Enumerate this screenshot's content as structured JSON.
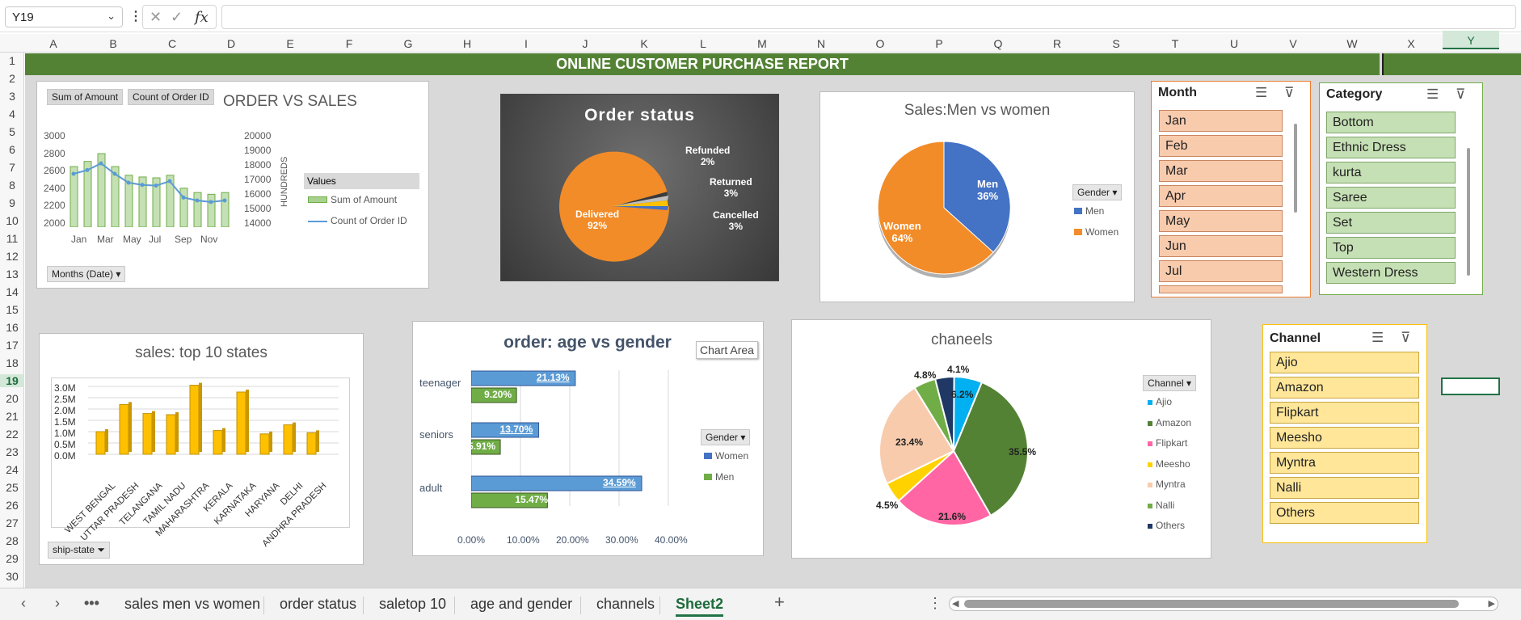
{
  "formula_bar": {
    "name_box": "Y19",
    "fx": "fx",
    "formula": ""
  },
  "columns": [
    [
      "A",
      66
    ],
    [
      "B",
      140
    ],
    [
      "C",
      213
    ],
    [
      "D",
      286
    ],
    [
      "E",
      359
    ],
    [
      "F",
      432
    ],
    [
      "G",
      505
    ],
    [
      "H",
      578
    ],
    [
      "I",
      651
    ],
    [
      "J",
      724
    ],
    [
      "K",
      797
    ],
    [
      "L",
      870
    ],
    [
      "M",
      943
    ],
    [
      "N",
      1016
    ],
    [
      "O",
      1089
    ],
    [
      "P",
      1162
    ],
    [
      "Q",
      1235
    ],
    [
      "R",
      1308
    ],
    [
      "S",
      1381
    ],
    [
      "T",
      1454
    ],
    [
      "U",
      1527
    ],
    [
      "V",
      1600
    ],
    [
      "W",
      1673
    ],
    [
      "X",
      1746
    ],
    [
      "Y",
      1820
    ]
  ],
  "rows": [
    "1",
    "2",
    "3",
    "4",
    "5",
    "6",
    "7",
    "8",
    "9",
    "10",
    "11",
    "12",
    "13",
    "14",
    "15",
    "16",
    "17",
    "18",
    "19",
    "20",
    "21",
    "22",
    "23",
    "24",
    "25",
    "26",
    "27",
    "28",
    "29",
    "30"
  ],
  "banner": "ONLINE  CUSTOMER PURCHASE REPORT",
  "chart1": {
    "title": "ORDER VS SALES",
    "field_buttons": [
      "Sum of Amount",
      "Count of Order ID"
    ],
    "y_left": [
      "3000",
      "2800",
      "2600",
      "2400",
      "2200",
      "2000"
    ],
    "y_right": [
      "20000",
      "19000",
      "18000",
      "17000",
      "16000",
      "15000",
      "14000"
    ],
    "y_right_label": "HUNDREDS",
    "x_labels": [
      "Jan",
      "Mar",
      "May",
      "Jul",
      "Sep",
      "Nov"
    ],
    "legend_title": "Values",
    "legend": [
      "Sum of Amount",
      "Count of Order ID"
    ],
    "axis_button": "Months (Date)"
  },
  "chart2": {
    "title": "Order status",
    "labels": [
      [
        "Delivered",
        "92%"
      ],
      [
        "Refunded",
        "2%"
      ],
      [
        "Returned",
        "3%"
      ],
      [
        "Cancelled",
        "3%"
      ]
    ]
  },
  "chart3": {
    "title": "Sales:Men vs women",
    "labels": [
      [
        "Men",
        "36%"
      ],
      [
        "Women",
        "64%"
      ]
    ],
    "legend_button": "Gender",
    "legend": [
      "Men",
      "Women"
    ]
  },
  "chart4": {
    "title": "sales: top 10 states",
    "y_labels": [
      "3.0M",
      "2.5M",
      "2.0M",
      "1.5M",
      "1.0M",
      "0.5M",
      "0.0M"
    ],
    "states": [
      "WEST BENGAL",
      "UTTAR PRADESH",
      "TELANGANA",
      "TAMIL NADU",
      "MAHARASHTRA",
      "KERALA",
      "KARNATAKA",
      "HARYANA",
      "DELHI",
      "ANDHRA PRADESH"
    ],
    "filter_button": "ship-state"
  },
  "chart5": {
    "title": "order: age vs gender",
    "tooltip": "Chart Area",
    "groups": [
      {
        "name": "teenager",
        "women": "21.13%",
        "men": "9.20%"
      },
      {
        "name": "seniors",
        "women": "13.70%",
        "men": "5.91%"
      },
      {
        "name": "adult",
        "women": "34.59%",
        "men": "15.47%"
      }
    ],
    "x_labels": [
      "0.00%",
      "10.00%",
      "20.00%",
      "30.00%",
      "40.00%"
    ],
    "legend_button": "Gender",
    "legend": [
      "Women",
      "Men"
    ]
  },
  "chart6": {
    "title": "chaneels",
    "labels": [
      "6.2%",
      "35.5%",
      "21.6%",
      "4.5%",
      "23.4%",
      "4.8%",
      "4.1%"
    ],
    "legend_button": "Channel",
    "legend": [
      "Ajio",
      "Amazon",
      "Flipkart",
      "Meesho",
      "Myntra",
      "Nalli",
      "Others"
    ]
  },
  "slicer_month": {
    "title": "Month",
    "items": [
      "Jan",
      "Feb",
      "Mar",
      "Apr",
      "May",
      "Jun",
      "Jul"
    ]
  },
  "slicer_category": {
    "title": "Category",
    "items": [
      "Bottom",
      "Ethnic Dress",
      "kurta",
      "Saree",
      "Set",
      "Top",
      "Western Dress"
    ]
  },
  "slicer_channel": {
    "title": "Channel",
    "items": [
      "Ajio",
      "Amazon",
      "Flipkart",
      "Meesho",
      "Myntra",
      "Nalli",
      "Others"
    ]
  },
  "tabs": [
    "sales men vs women",
    "order status",
    "saletop 10",
    "age and gender",
    "channels",
    "Sheet2"
  ],
  "active_tab": "Sheet2",
  "colors": {
    "excel_green": "#217346",
    "banner": "#548235",
    "grid_bg": "#d9d9d9",
    "women": "#4472c4",
    "men": "#70ad47"
  }
}
